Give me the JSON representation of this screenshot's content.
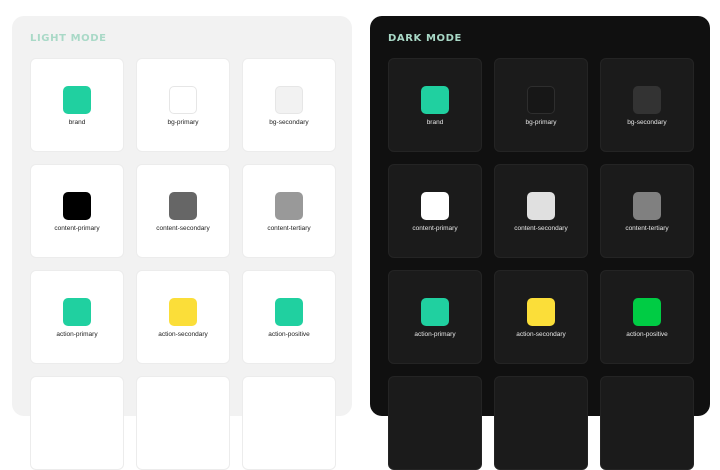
{
  "light": {
    "title": "LIGHT MODE",
    "tokens": [
      {
        "label": "brand",
        "color": "#20d0a0"
      },
      {
        "label": "bg-primary",
        "color": "#ffffff"
      },
      {
        "label": "bg-secondary",
        "color": "#f2f2f2"
      },
      {
        "label": "content-primary",
        "color": "#000000"
      },
      {
        "label": "content-secondary",
        "color": "#666666"
      },
      {
        "label": "content-tertiary",
        "color": "#999999"
      },
      {
        "label": "action-primary",
        "color": "#20d0a0"
      },
      {
        "label": "action-secondary",
        "color": "#fbde39"
      },
      {
        "label": "action-positive",
        "color": "#20d0a0"
      }
    ]
  },
  "dark": {
    "title": "DARK MODE",
    "tokens": [
      {
        "label": "brand",
        "color": "#20d0a0"
      },
      {
        "label": "bg-primary",
        "color": "#171717"
      },
      {
        "label": "bg-secondary",
        "color": "#333333"
      },
      {
        "label": "content-primary",
        "color": "#ffffff"
      },
      {
        "label": "content-secondary",
        "color": "#e0e0e0"
      },
      {
        "label": "content-tertiary",
        "color": "#808080"
      },
      {
        "label": "action-primary",
        "color": "#20d0a0"
      },
      {
        "label": "action-secondary",
        "color": "#fbde39"
      },
      {
        "label": "action-positive",
        "color": "#00cc44"
      }
    ]
  }
}
